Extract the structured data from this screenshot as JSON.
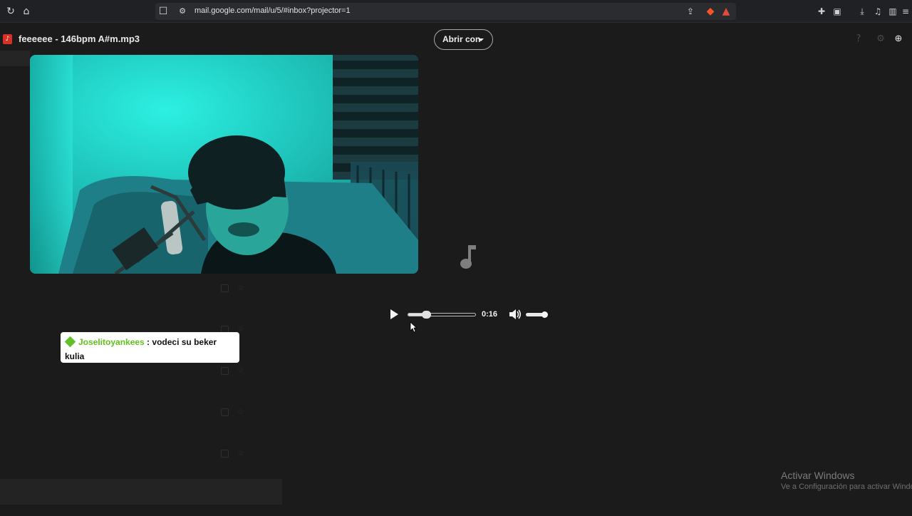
{
  "browser": {
    "url": "mail.google.com/mail/u/5/#inbox?projector=1"
  },
  "projector": {
    "file_title": "feeeeee - 146bpm A#m.mp3",
    "open_with_label": "Abrir con"
  },
  "audio": {
    "time": "0:16",
    "progress_fraction": 0.27,
    "volume_fraction": 0.8,
    "playing": false
  },
  "chat": {
    "username": "Joselitoyankees",
    "separator": " : ",
    "message": "vodeci su beker kulia"
  },
  "watermark": {
    "title": "Activar Windows",
    "subtitle": "Ve a Configuración para activar Windows."
  },
  "colors": {
    "chat_user": "#63c120",
    "file_icon": "#d93025"
  },
  "icons": {
    "reload": "reload-icon",
    "home": "home-icon",
    "bookmark": "bookmark-icon",
    "site_info": "site-settings-icon",
    "music": "music-note-icon",
    "volume": "volume-icon",
    "play": "play-icon"
  }
}
